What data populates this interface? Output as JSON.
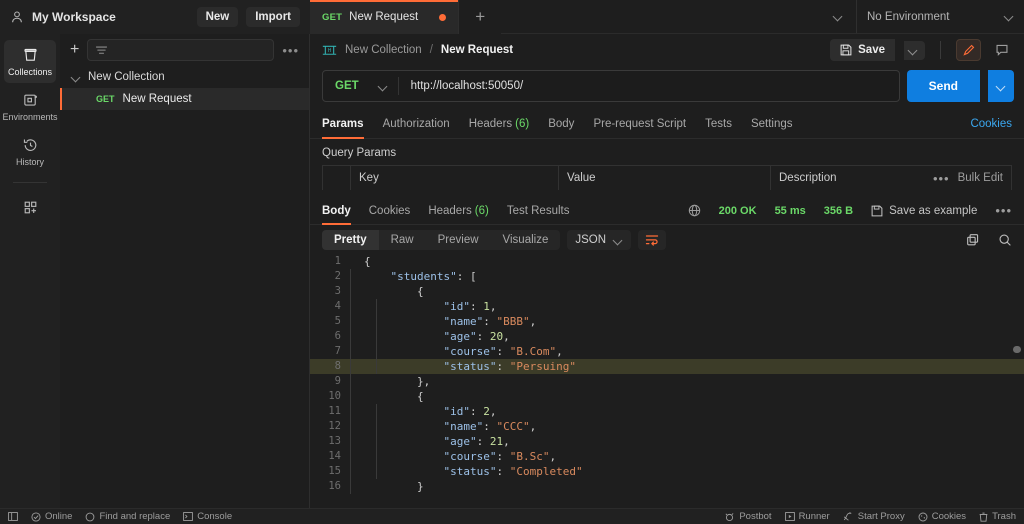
{
  "workspace": {
    "name": "My Workspace",
    "new_label": "New",
    "import_label": "Import",
    "person_icon": "person-icon"
  },
  "tabs": {
    "open": [
      {
        "method": "GET",
        "name": "New Request",
        "unsaved": true
      }
    ],
    "add_label": "+",
    "list_chevron": "chevron-down-icon"
  },
  "environment": {
    "selected": "No Environment"
  },
  "rail": {
    "items": [
      {
        "label": "Collections",
        "icon": "collections-icon",
        "active": true
      },
      {
        "label": "Environments",
        "icon": "environments-icon",
        "active": false
      },
      {
        "label": "History",
        "icon": "history-icon",
        "active": false
      }
    ],
    "new_icon": "new-grid-icon"
  },
  "sidebar": {
    "add_label": "+",
    "filter_icon": "filter-icon",
    "more_label": "•••",
    "collection": {
      "name": "New Collection",
      "expanded": true
    },
    "requests": [
      {
        "method": "GET",
        "name": "New Request",
        "selected": true
      }
    ]
  },
  "breadcrumb": {
    "http_icon": "http-icon",
    "collection": "New Collection",
    "separator": "/",
    "current": "New Request"
  },
  "actions": {
    "save_label": "Save",
    "save_icon": "floppy-icon",
    "save_chevron": "chevron-down-icon",
    "edit_icon": "pencil-icon",
    "comment_icon": "comment-icon"
  },
  "request": {
    "method": "GET",
    "method_chevron": "chevron-down-icon",
    "url": "http://localhost:50050/",
    "send_label": "Send",
    "send_chevron": "chevron-down-icon"
  },
  "request_tabs": [
    {
      "label": "Params",
      "count": "",
      "active": true
    },
    {
      "label": "Authorization",
      "count": "",
      "active": false
    },
    {
      "label": "Headers",
      "count": "(6)",
      "active": false
    },
    {
      "label": "Body",
      "count": "",
      "active": false
    },
    {
      "label": "Pre-request Script",
      "count": "",
      "active": false
    },
    {
      "label": "Tests",
      "count": "",
      "active": false
    },
    {
      "label": "Settings",
      "count": "",
      "active": false
    }
  ],
  "cookies_link": "Cookies",
  "query_params": {
    "title": "Query Params",
    "columns": [
      "Key",
      "Value",
      "Description"
    ],
    "more_label": "•••",
    "bulk_edit_label": "Bulk Edit",
    "rows": []
  },
  "response": {
    "tabs": [
      {
        "label": "Body",
        "count": "",
        "active": true
      },
      {
        "label": "Cookies",
        "count": "",
        "active": false
      },
      {
        "label": "Headers",
        "count": "(6)",
        "active": false
      },
      {
        "label": "Test Results",
        "count": "",
        "active": false
      }
    ],
    "globe_icon": "globe-icon",
    "status": "200 OK",
    "time": "55 ms",
    "size": "356 B",
    "save_example_label": "Save as example",
    "save_example_icon": "floppy-icon",
    "more_label": "•••",
    "formats": [
      {
        "label": "Pretty",
        "active": true
      },
      {
        "label": "Raw",
        "active": false
      },
      {
        "label": "Preview",
        "active": false
      },
      {
        "label": "Visualize",
        "active": false
      }
    ],
    "language": "JSON",
    "language_chevron": "chevron-down-icon",
    "wrap_icon": "wrap-lines-icon",
    "copy_icon": "copy-icon",
    "search_icon": "search-icon",
    "highlighted_line": 8,
    "lines": [
      {
        "n": 1,
        "ind": 0,
        "tokens": [
          {
            "t": "p",
            "v": "{"
          }
        ]
      },
      {
        "n": 2,
        "ind": 1,
        "tokens": [
          {
            "t": "k",
            "v": "\"students\""
          },
          {
            "t": "p",
            "v": ": ["
          }
        ]
      },
      {
        "n": 3,
        "ind": 2,
        "tokens": [
          {
            "t": "p",
            "v": "{"
          }
        ]
      },
      {
        "n": 4,
        "ind": 3,
        "tokens": [
          {
            "t": "k",
            "v": "\"id\""
          },
          {
            "t": "p",
            "v": ": "
          },
          {
            "t": "n",
            "v": "1"
          },
          {
            "t": "p",
            "v": ","
          }
        ]
      },
      {
        "n": 5,
        "ind": 3,
        "tokens": [
          {
            "t": "k",
            "v": "\"name\""
          },
          {
            "t": "p",
            "v": ": "
          },
          {
            "t": "s",
            "v": "\"BBB\""
          },
          {
            "t": "p",
            "v": ","
          }
        ]
      },
      {
        "n": 6,
        "ind": 3,
        "tokens": [
          {
            "t": "k",
            "v": "\"age\""
          },
          {
            "t": "p",
            "v": ": "
          },
          {
            "t": "n",
            "v": "20"
          },
          {
            "t": "p",
            "v": ","
          }
        ]
      },
      {
        "n": 7,
        "ind": 3,
        "tokens": [
          {
            "t": "k",
            "v": "\"course\""
          },
          {
            "t": "p",
            "v": ": "
          },
          {
            "t": "s",
            "v": "\"B.Com\""
          },
          {
            "t": "p",
            "v": ","
          }
        ]
      },
      {
        "n": 8,
        "ind": 3,
        "tokens": [
          {
            "t": "k",
            "v": "\"status\""
          },
          {
            "t": "p",
            "v": ": "
          },
          {
            "t": "s",
            "v": "\"Persuing\""
          }
        ]
      },
      {
        "n": 9,
        "ind": 2,
        "tokens": [
          {
            "t": "p",
            "v": "},"
          }
        ]
      },
      {
        "n": 10,
        "ind": 2,
        "tokens": [
          {
            "t": "p",
            "v": "{"
          }
        ]
      },
      {
        "n": 11,
        "ind": 3,
        "tokens": [
          {
            "t": "k",
            "v": "\"id\""
          },
          {
            "t": "p",
            "v": ": "
          },
          {
            "t": "n",
            "v": "2"
          },
          {
            "t": "p",
            "v": ","
          }
        ]
      },
      {
        "n": 12,
        "ind": 3,
        "tokens": [
          {
            "t": "k",
            "v": "\"name\""
          },
          {
            "t": "p",
            "v": ": "
          },
          {
            "t": "s",
            "v": "\"CCC\""
          },
          {
            "t": "p",
            "v": ","
          }
        ]
      },
      {
        "n": 13,
        "ind": 3,
        "tokens": [
          {
            "t": "k",
            "v": "\"age\""
          },
          {
            "t": "p",
            "v": ": "
          },
          {
            "t": "n",
            "v": "21"
          },
          {
            "t": "p",
            "v": ","
          }
        ]
      },
      {
        "n": 14,
        "ind": 3,
        "tokens": [
          {
            "t": "k",
            "v": "\"course\""
          },
          {
            "t": "p",
            "v": ": "
          },
          {
            "t": "s",
            "v": "\"B.Sc\""
          },
          {
            "t": "p",
            "v": ","
          }
        ]
      },
      {
        "n": 15,
        "ind": 3,
        "tokens": [
          {
            "t": "k",
            "v": "\"status\""
          },
          {
            "t": "p",
            "v": ": "
          },
          {
            "t": "s",
            "v": "\"Completed\""
          }
        ]
      },
      {
        "n": 16,
        "ind": 2,
        "tokens": [
          {
            "t": "p",
            "v": "}"
          }
        ]
      }
    ]
  },
  "statusbar": {
    "left": [
      {
        "label": "",
        "icon": "sidebar-toggle-icon"
      },
      {
        "label": "Online",
        "icon": "check-circle-icon"
      },
      {
        "label": "Find and replace",
        "icon": "search-circle-icon"
      },
      {
        "label": "Console",
        "icon": "terminal-icon"
      }
    ],
    "right": [
      {
        "label": "Postbot",
        "icon": "postbot-icon"
      },
      {
        "label": "Runner",
        "icon": "runner-icon"
      },
      {
        "label": "Start Proxy",
        "icon": "proxy-icon"
      },
      {
        "label": "Cookies",
        "icon": "cookies-icon"
      },
      {
        "label": "Trash",
        "icon": "trash-icon"
      }
    ]
  },
  "colors": {
    "accent": "#ff6c37",
    "send": "#0f7ee0",
    "success": "#6bd968",
    "link": "#3ba7ef",
    "json_key": "#9cc0e7",
    "json_string": "#d98a5e",
    "json_number": "#c8e1a0",
    "highlight": "#3c3c28"
  }
}
